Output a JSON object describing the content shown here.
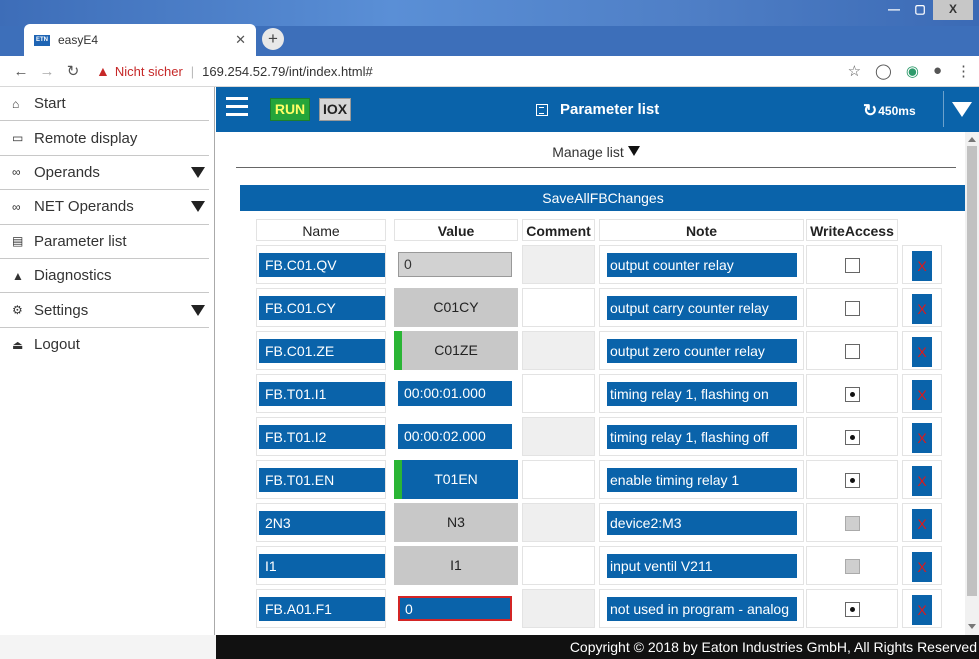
{
  "browser": {
    "tab_title": "easyE4",
    "favicon_text": "ETN",
    "new_tab": "+",
    "insecure_label": "Nicht sicher",
    "url": "169.254.52.79/int/index.html#"
  },
  "sidebar": {
    "items": [
      {
        "label": "Start",
        "icon": "home-icon",
        "glyph": "⌂"
      },
      {
        "label": "Remote display",
        "icon": "monitor-icon",
        "glyph": "▭"
      },
      {
        "label": "Operands",
        "icon": "glasses-icon",
        "glyph": "∞"
      },
      {
        "label": "NET Operands",
        "icon": "glasses-icon",
        "glyph": "∞"
      },
      {
        "label": "Parameter list",
        "icon": "list-icon",
        "glyph": "▤"
      },
      {
        "label": "Diagnostics",
        "icon": "warning-icon",
        "glyph": "▲"
      },
      {
        "label": "Settings",
        "icon": "gear-icon",
        "glyph": "⚙"
      },
      {
        "label": "Logout",
        "icon": "user-icon",
        "glyph": "⏏"
      }
    ]
  },
  "header": {
    "run": "RUN",
    "iox": "IOX",
    "title": "Parameter list",
    "refresh": "450ms"
  },
  "content": {
    "manage_list": "Manage list",
    "save_all": "SaveAllFBChanges",
    "columns": {
      "name": "Name",
      "value": "Value",
      "comment": "Comment",
      "note": "Note",
      "write_access": "WriteAccess"
    },
    "rows": [
      {
        "name": "FB.C01.QV",
        "value": "0",
        "note": "output counter relay",
        "write": "unchecked"
      },
      {
        "name": "FB.C01.CY",
        "value": "C01CY",
        "note": "output carry counter relay",
        "write": "unchecked"
      },
      {
        "name": "FB.C01.ZE",
        "value": "C01ZE",
        "note": "output zero counter relay",
        "write": "unchecked"
      },
      {
        "name": "FB.T01.I1",
        "value": "00:00:01.000",
        "note": "timing relay 1, flashing on",
        "write": "checked"
      },
      {
        "name": "FB.T01.I2",
        "value": "00:00:02.000",
        "note": "timing relay 1, flashing off",
        "write": "checked"
      },
      {
        "name": "FB.T01.EN",
        "value": "T01EN",
        "note": "enable timing relay 1",
        "write": "checked"
      },
      {
        "name": "2N3",
        "value": "N3",
        "note": "device2:M3",
        "write": "disabled"
      },
      {
        "name": "I1",
        "value": "I1",
        "note": "input ventil V211",
        "write": "disabled"
      },
      {
        "name": "FB.A01.F1",
        "value": "0",
        "note": "not used in program - analog",
        "write": "checked"
      }
    ],
    "delete_label": "X"
  },
  "footer": {
    "copyright": "Copyright © 2018 by Eaton Industries GmbH, All Rights Reserved"
  }
}
